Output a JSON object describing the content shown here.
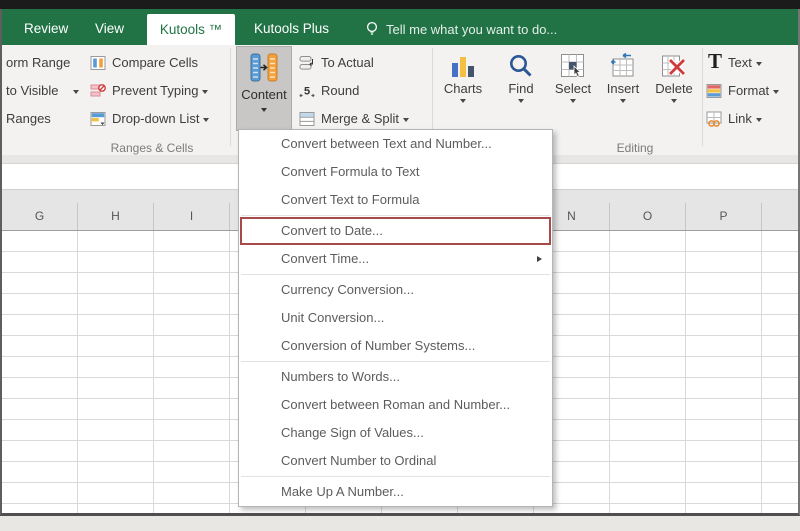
{
  "tabs": {
    "review": "Review",
    "view": "View",
    "kutools": "Kutools ™",
    "kutools_plus": "Kutools Plus",
    "tell_me": "Tell me what you want to do..."
  },
  "ribbon": {
    "cut_labels": {
      "row1": "orm Range",
      "row2": "to Visible",
      "row3": "Ranges"
    },
    "ranges_cells": {
      "compare_cells": "Compare Cells",
      "prevent_typing": "Prevent Typing",
      "dropdown_list": "Drop-down List",
      "group_label": "Ranges & Cells"
    },
    "content_group": {
      "content": "Content",
      "to_actual": "To Actual",
      "round": "Round",
      "merge_split": "Merge & Split"
    },
    "editing_group": {
      "charts": "Charts",
      "find": "Find",
      "select": "Select",
      "insert": "Insert",
      "delete": "Delete",
      "group_label": "Editing"
    },
    "text_group": {
      "text": "Text",
      "format": "Format",
      "link": "Link"
    }
  },
  "content_menu": {
    "items": [
      {
        "label": "Convert between Text and Number..."
      },
      {
        "label": "Convert Formula to Text"
      },
      {
        "label": "Convert Text to Formula"
      },
      {
        "label": "Convert to Date...",
        "highlighted": true
      },
      {
        "label": "Convert Time...",
        "has_submenu": true
      },
      {
        "label": "Currency Conversion..."
      },
      {
        "label": "Unit Conversion..."
      },
      {
        "label": "Conversion of Number Systems..."
      },
      {
        "label": "Numbers to Words..."
      },
      {
        "label": "Convert between Roman and Number..."
      },
      {
        "label": "Change Sign of Values..."
      },
      {
        "label": "Convert Number to Ordinal"
      },
      {
        "label": "Make Up A Number..."
      }
    ],
    "highlight_color": "#a94a4a"
  },
  "sheet": {
    "columns": [
      {
        "label": "G"
      },
      {
        "label": "H"
      },
      {
        "label": "I"
      },
      {
        "label": "N"
      },
      {
        "label": "O"
      },
      {
        "label": "P"
      }
    ]
  }
}
